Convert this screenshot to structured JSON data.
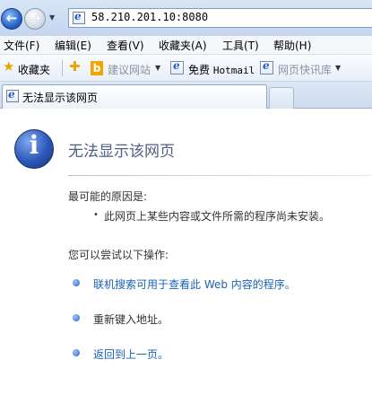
{
  "address_bar": {
    "url": "58.210.201.10:8080"
  },
  "menu": {
    "items": [
      {
        "label": "文件(F)"
      },
      {
        "label": "编辑(E)"
      },
      {
        "label": "查看(V)"
      },
      {
        "label": "收藏夹(A)"
      },
      {
        "label": "工具(T)"
      },
      {
        "label": "帮助(H)"
      }
    ]
  },
  "favorites_bar": {
    "favorites_label": "收藏夹",
    "suggested_sites": "建议网站",
    "hotmail_prefix": "免费",
    "hotmail_name": "Hotmail",
    "web_slice_gallery": "网页快讯库"
  },
  "tabs": [
    {
      "label": "无法显示该网页",
      "active": true
    }
  ],
  "error_page": {
    "title": "无法显示该网页",
    "cause_heading": "最可能的原因是:",
    "causes": [
      "此网页上某些内容或文件所需的程序尚未安装。"
    ],
    "try_heading": "您可以尝试以下操作:",
    "options": [
      {
        "text": "联机搜索可用于查看此 Web 内容的程序。",
        "is_link": true
      },
      {
        "text": "重新键入地址。",
        "is_link": false
      },
      {
        "text": "返回到上一页。",
        "is_link": true
      }
    ]
  },
  "icons": {
    "back": "back-arrow-icon",
    "forward": "forward-arrow-icon",
    "page": "ie-page-icon",
    "favorites": "star-icon",
    "add_favorite": "add-favorite-star-icon",
    "bing": "bing-icon",
    "info": "info-icon"
  },
  "colors": {
    "title": "#4d6185",
    "link": "#1a62b5",
    "chrome": "#c3d6ef"
  }
}
